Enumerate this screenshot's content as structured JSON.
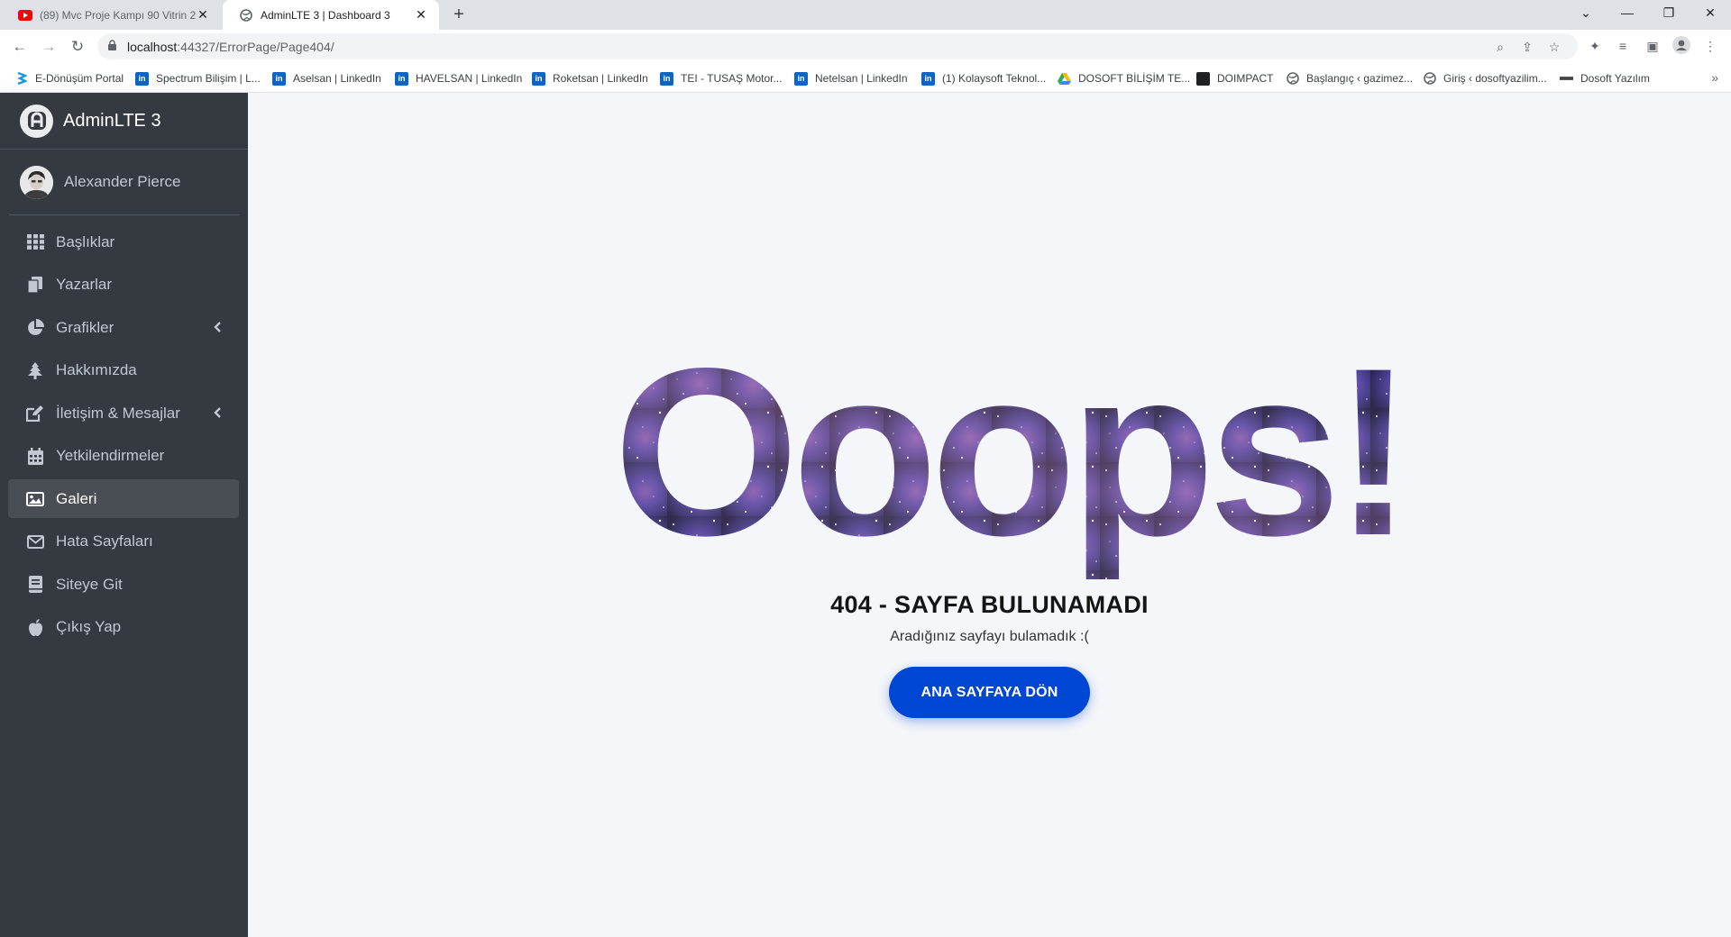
{
  "browser": {
    "tabs": [
      {
        "title": "(89) Mvc Proje Kampı 90 Vitrin 2",
        "icon": "youtube-icon"
      },
      {
        "title": "AdminLTE 3 | Dashboard 3",
        "icon": "globe-icon"
      }
    ],
    "url_host": "localhost",
    "url_path": ":44327/ErrorPage/Page404/",
    "bookmarks": [
      {
        "label": "E-Dönüşüm Portal",
        "icon": "edonusum-icon"
      },
      {
        "label": "Spectrum Bilişim | L...",
        "icon": "linkedin-icon"
      },
      {
        "label": "Aselsan | LinkedIn",
        "icon": "linkedin-icon"
      },
      {
        "label": "HAVELSAN | LinkedIn",
        "icon": "linkedin-icon"
      },
      {
        "label": "Roketsan | LinkedIn",
        "icon": "linkedin-icon"
      },
      {
        "label": "TEI - TUSAŞ Motor...",
        "icon": "linkedin-icon"
      },
      {
        "label": "Netelsan | LinkedIn",
        "icon": "linkedin-icon"
      },
      {
        "label": "(1) Kolaysoft Teknol...",
        "icon": "linkedin-icon"
      },
      {
        "label": "DOSOFT BİLİŞİM TE...",
        "icon": "google-drive-icon"
      },
      {
        "label": "DOIMPACT",
        "icon": "square-icon"
      },
      {
        "label": "Başlangıç ‹ gazimez...",
        "icon": "globe-icon"
      },
      {
        "label": "Giriş ‹ dosoftyazilim...",
        "icon": "globe-icon"
      },
      {
        "label": "Dosoft Yazılım",
        "icon": "dash-icon"
      }
    ]
  },
  "sidebar": {
    "brand": "AdminLTE 3",
    "user": "Alexander Pierce",
    "items": [
      {
        "label": "Başlıklar",
        "icon": "th-icon"
      },
      {
        "label": "Yazarlar",
        "icon": "copy-icon"
      },
      {
        "label": "Grafikler",
        "icon": "chart-pie-icon",
        "has_children": true
      },
      {
        "label": "Hakkımızda",
        "icon": "tree-icon"
      },
      {
        "label": "İletişim & Mesajlar",
        "icon": "edit-icon",
        "has_children": true
      },
      {
        "label": "Yetkilendirmeler",
        "icon": "calendar-icon"
      },
      {
        "label": "Galeri",
        "icon": "image-icon",
        "active": true
      },
      {
        "label": "Hata Sayfaları",
        "icon": "envelope-icon"
      },
      {
        "label": "Siteye Git",
        "icon": "book-icon"
      },
      {
        "label": "Çıkış Yap",
        "icon": "apple-icon"
      }
    ]
  },
  "error": {
    "headline": "Ooops!",
    "title": "404 - SAYFA BULUNAMADI",
    "subtitle": "Aradığınız sayfayı bulamadık :(",
    "button": "ANA SAYFAYA DÖN"
  },
  "colors": {
    "sidebar_bg": "#343a40",
    "content_bg": "#f4f6f9",
    "button_bg": "#0046d5",
    "galaxy_dark": "#1c1748",
    "galaxy_mid": "#4a3a9c"
  }
}
